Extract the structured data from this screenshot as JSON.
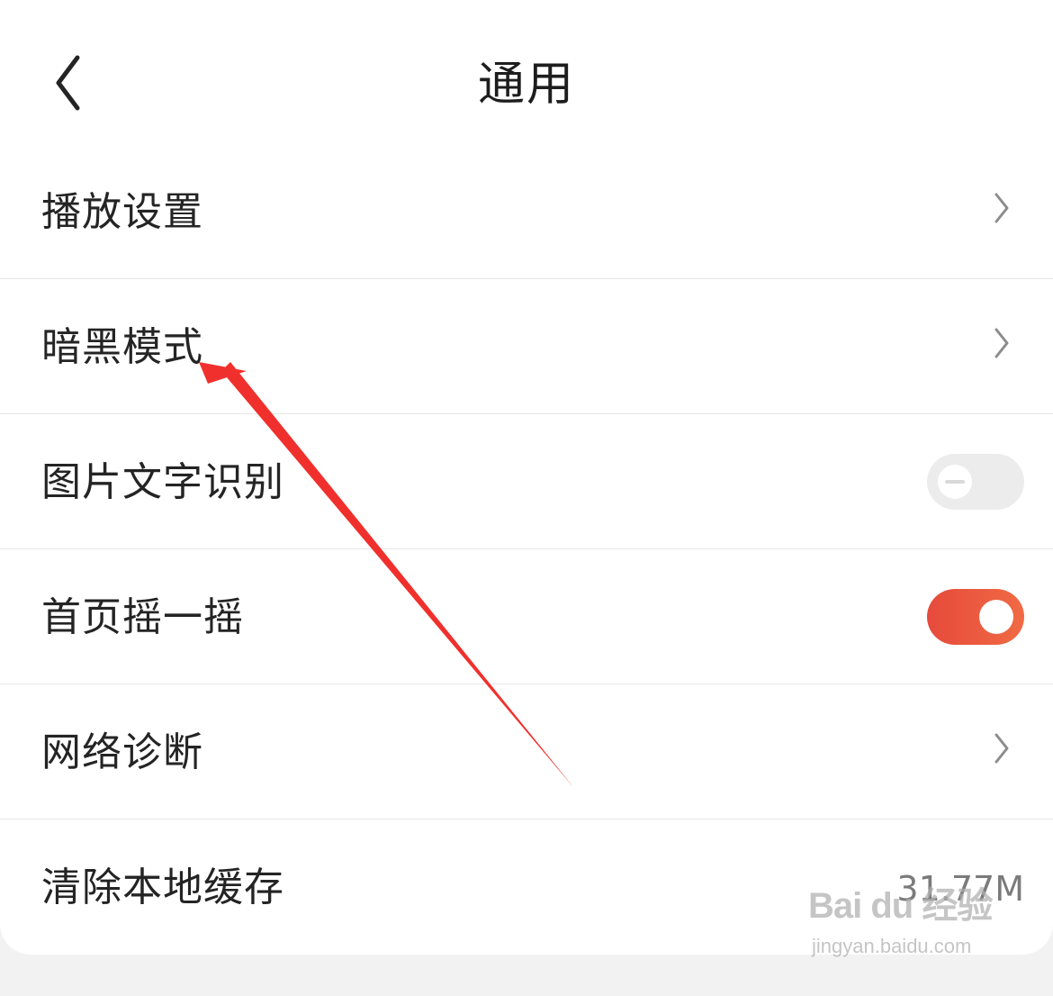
{
  "header": {
    "title": "通用",
    "back_icon": "chevron-left-icon"
  },
  "settings": {
    "playback_settings": "播放设置",
    "dark_mode": "暗黑模式",
    "image_text_recognition": "图片文字识别",
    "home_shake": "首页摇一摇",
    "network_diagnosis": "网络诊断",
    "clear_local_cache": "清除本地缓存",
    "cache_size": "31.77M"
  },
  "toggles": {
    "image_text_recognition_enabled": false,
    "home_shake_enabled": true
  },
  "annotation": {
    "arrow_color": "#f0302c",
    "arrow_points_to": "dark_mode"
  },
  "watermark": {
    "brand": "Bai du 经验",
    "url": "jingyan.baidu.com"
  },
  "colors": {
    "accent": "#e64a3b",
    "background": "#f2f2f2",
    "panel": "#ffffff",
    "text_primary": "#242424",
    "text_secondary": "#7b7b7b"
  }
}
